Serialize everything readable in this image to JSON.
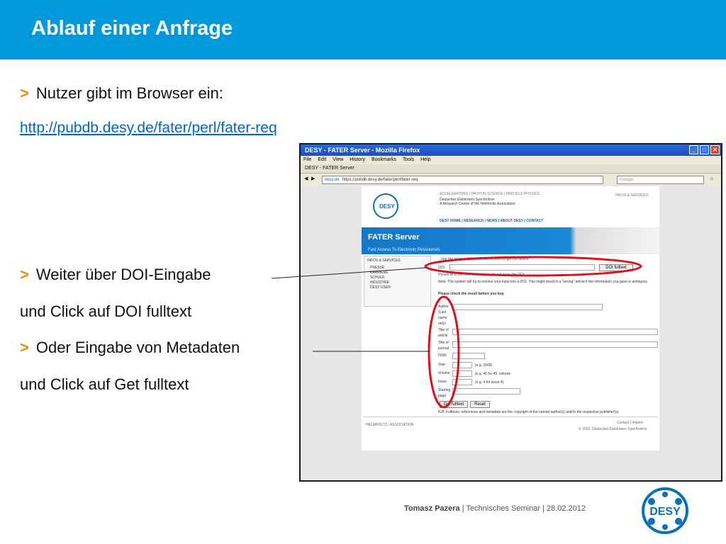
{
  "slide": {
    "title": "Ablauf einer Anfrage",
    "bullet1": "Nutzer gibt im Browser ein:",
    "url": "http://pubdb.desy.de/fater/perl/fater-req",
    "bullet2": "Weiter über DOI-Eingabe",
    "line2b": "und Click auf  DOI fulltext",
    "bullet3": "Oder Eingabe von Metadaten",
    "line3b": "und Click auf Get fulltext",
    "marker": ">"
  },
  "browser": {
    "window_title": "DESY - FATER Server - Mozilla Firefox",
    "menu": [
      "File",
      "Edit",
      "View",
      "History",
      "Bookmarks",
      "Tools",
      "Help"
    ],
    "tab_label": "DESY - FATER Server",
    "url_domain": "desy.de",
    "url_value": "https://pubdb.desy.de/fater/perl/fater-req",
    "search_placeholder": "Google"
  },
  "webpage": {
    "top_links": "ACCELERATORS | PHOTON SCIENCE | PARTICLE PHYSICS",
    "org_line1": "Deutsches Elektronen-Synchrotron",
    "org_line2": "A Research Centre of the Helmholtz Association",
    "infos_link": "INFOS & SERVICES",
    "logo_text": "DESY",
    "nav": "DESY HOME  | RESEARCH  | NEWS  | ABOUT DESY  | CONTACT",
    "banner_title": "FATER Server",
    "banner_subtitle": "Fast Access To Electronic Ressources",
    "sidebar_heading": "INFOS & SERVICES",
    "sidebar_items": [
      "PRESSE",
      "KARRIERE",
      "SCHULE",
      "INDUSTRIE",
      "DESY USER"
    ],
    "intro": "...nter the article's DOI or fill out the form to get the fulltext",
    "doi_label": "DOI",
    "doi_button": "DOI fulltext",
    "doi_help": "Please fill in the form below if you do not know the DOI",
    "note": "Note: The system will try to resolve your input into a DOI. This might result in a \"wrong\" article if the information you gave is ambigous.",
    "check": "Please check the result before you buy.",
    "form_labels": [
      "Author",
      "(Last",
      "name",
      "only)",
      "Title of",
      "article",
      "Title of",
      "journal",
      "ISSN",
      "Year",
      "Volume",
      "Issue",
      "Starting",
      "page"
    ],
    "year_hint": "(e.g. 2009)",
    "volume_hint": "(e.g. 45 for 45. volume",
    "issue_hint": "(e.g. 4 for issue 4)",
    "get_button": "Get fulltext",
    "reset_button": "Reset",
    "nb_text": "N.B. Fulltexts, references and metadata are the copyright of the named author(s) and/or the respective publisher(s).",
    "helmholtz": "HELMHOLTZ | ASSOCIATION",
    "contact": "Contact | Imprint",
    "copyright": "© 2010, Deutsches Elektronen-Synchrotron"
  },
  "footer": {
    "author": "Tomasz Pazera",
    "rest": "  |  Technisches Seminar |  28.02.2012"
  },
  "colors": {
    "header_bg": "#0099dc",
    "marker": "#f08a00",
    "link": "#0066cc",
    "highlight_ellipse": "#e0101a"
  }
}
